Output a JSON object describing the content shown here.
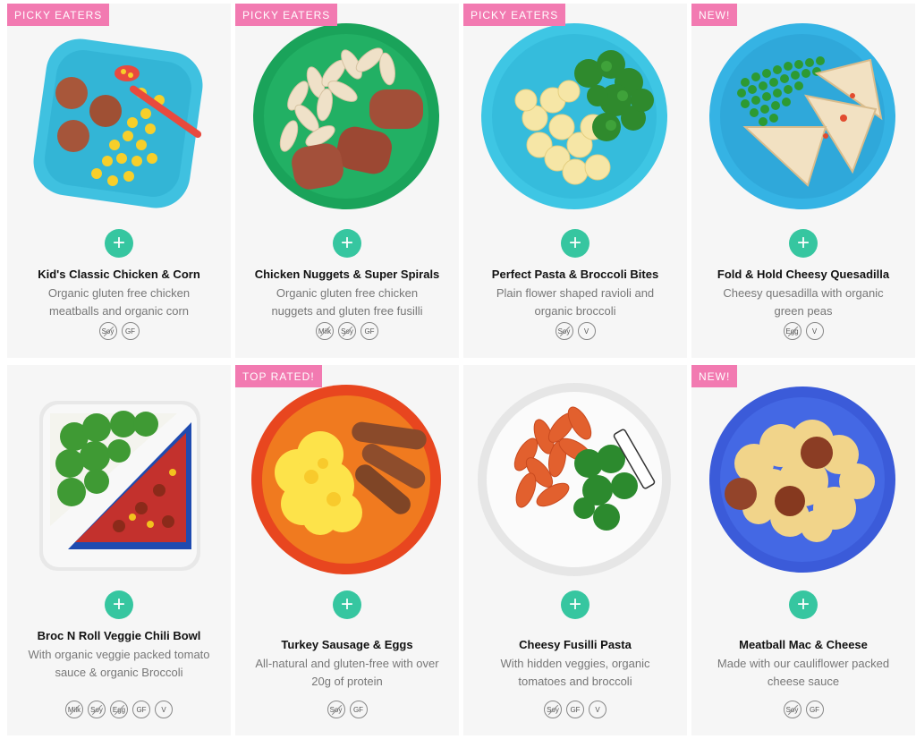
{
  "add_label": "+",
  "colors": {
    "badge": "#f27ab1",
    "add_button": "#36c6a0"
  },
  "cards": [
    {
      "badge": "PICKY EATERS",
      "name": "Kid's Classic Chicken & Corn",
      "description": "Organic gluten free chicken meatballs and organic corn",
      "tags": [
        "Soy",
        "GF"
      ]
    },
    {
      "badge": "PICKY EATERS",
      "name": "Chicken Nuggets & Super Spirals",
      "description": "Organic gluten free chicken nuggets and gluten free fusilli",
      "tags": [
        "Milk",
        "Soy",
        "GF"
      ]
    },
    {
      "badge": "PICKY EATERS",
      "name": "Perfect Pasta & Broccoli Bites",
      "description": "Plain flower shaped ravioli and organic broccoli",
      "tags": [
        "Soy",
        "V"
      ]
    },
    {
      "badge": "NEW!",
      "name": "Fold & Hold Cheesy Quesadilla",
      "description": "Cheesy quesadilla with organic green peas",
      "tags": [
        "Egg",
        "V"
      ]
    },
    {
      "badge": "",
      "name": "Broc N Roll Veggie Chili Bowl",
      "description": "With organic veggie packed tomato sauce & organic Broccoli",
      "tags": [
        "Milk",
        "Soy",
        "Egg",
        "GF",
        "V"
      ]
    },
    {
      "badge": "TOP RATED!",
      "name": "Turkey Sausage & Eggs",
      "description": "All-natural and gluten-free with over 20g of protein",
      "tags": [
        "Soy",
        "GF"
      ]
    },
    {
      "badge": "",
      "name": "Cheesy Fusilli Pasta",
      "description": "With hidden veggies, organic tomatoes and broccoli",
      "tags": [
        "Soy",
        "GF",
        "V"
      ]
    },
    {
      "badge": "NEW!",
      "name": "Meatball Mac & Cheese",
      "description": "Made with our cauliflower packed cheese sauce",
      "tags": [
        "Soy",
        "GF"
      ]
    }
  ]
}
